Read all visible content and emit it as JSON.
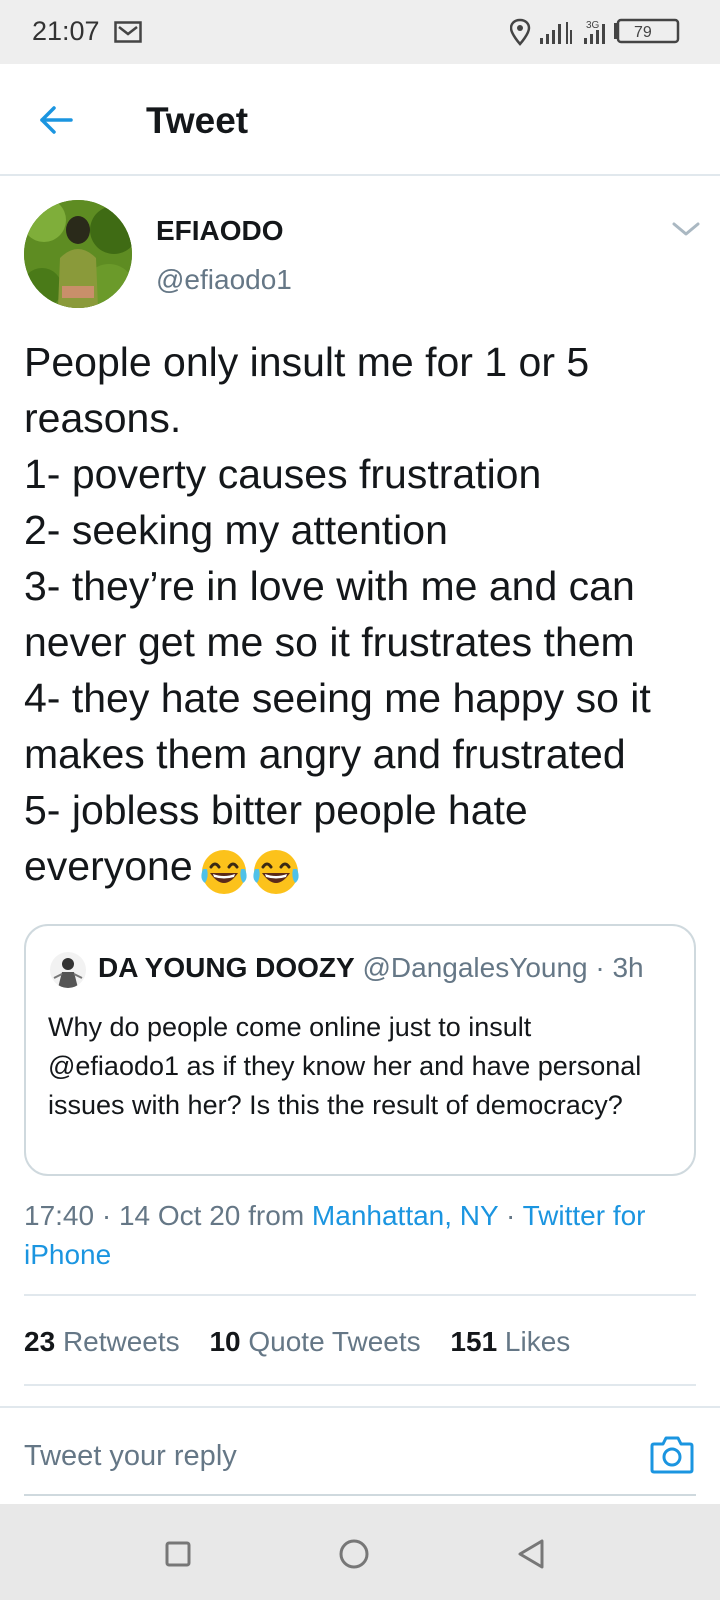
{
  "status_bar": {
    "time": "21:07",
    "network": "3G",
    "battery": "79"
  },
  "header": {
    "title": "Tweet"
  },
  "author": {
    "name": "EFIAODO",
    "handle": "@efiaodo1"
  },
  "tweet": {
    "text": "People only insult me for 1 or 5 reasons.\n1- poverty causes frustration\n2- seeking my attention\n3- they’re in love with me and can never get me so it frustrates them\n4- they hate seeing me happy so it makes them angry and frustrated\n5- jobless bitter people hate everyone"
  },
  "quote": {
    "name": "DA YOUNG DOOZY",
    "meta": " @DangalesYoung · 3h",
    "text": "Why do people come online just to insult @efiaodo1 as if they know her and have personal issues with her? Is this the result of democracy?"
  },
  "meta": {
    "time_date": "17:40 · 14 Oct 20 from ",
    "location": "Manhattan, NY",
    "separator": " · ",
    "source": "Twitter for iPhone"
  },
  "stats": [
    {
      "count": "23",
      "label": "Retweets"
    },
    {
      "count": "10",
      "label": "Quote Tweets"
    },
    {
      "count": "151",
      "label": "Likes"
    }
  ],
  "reply": {
    "placeholder": "Tweet your reply"
  },
  "colors": {
    "accent": "#1b95e0",
    "text": "#14171a",
    "muted": "#657786",
    "border": "#e1e8ed"
  },
  "icons": [
    "mail-icon",
    "location-icon",
    "signal-icon",
    "battery-icon",
    "back-arrow-icon",
    "chevron-down-icon",
    "laughing-crying-emoji",
    "camera-icon",
    "square-icon",
    "circle-icon",
    "triangle-back-icon"
  ]
}
